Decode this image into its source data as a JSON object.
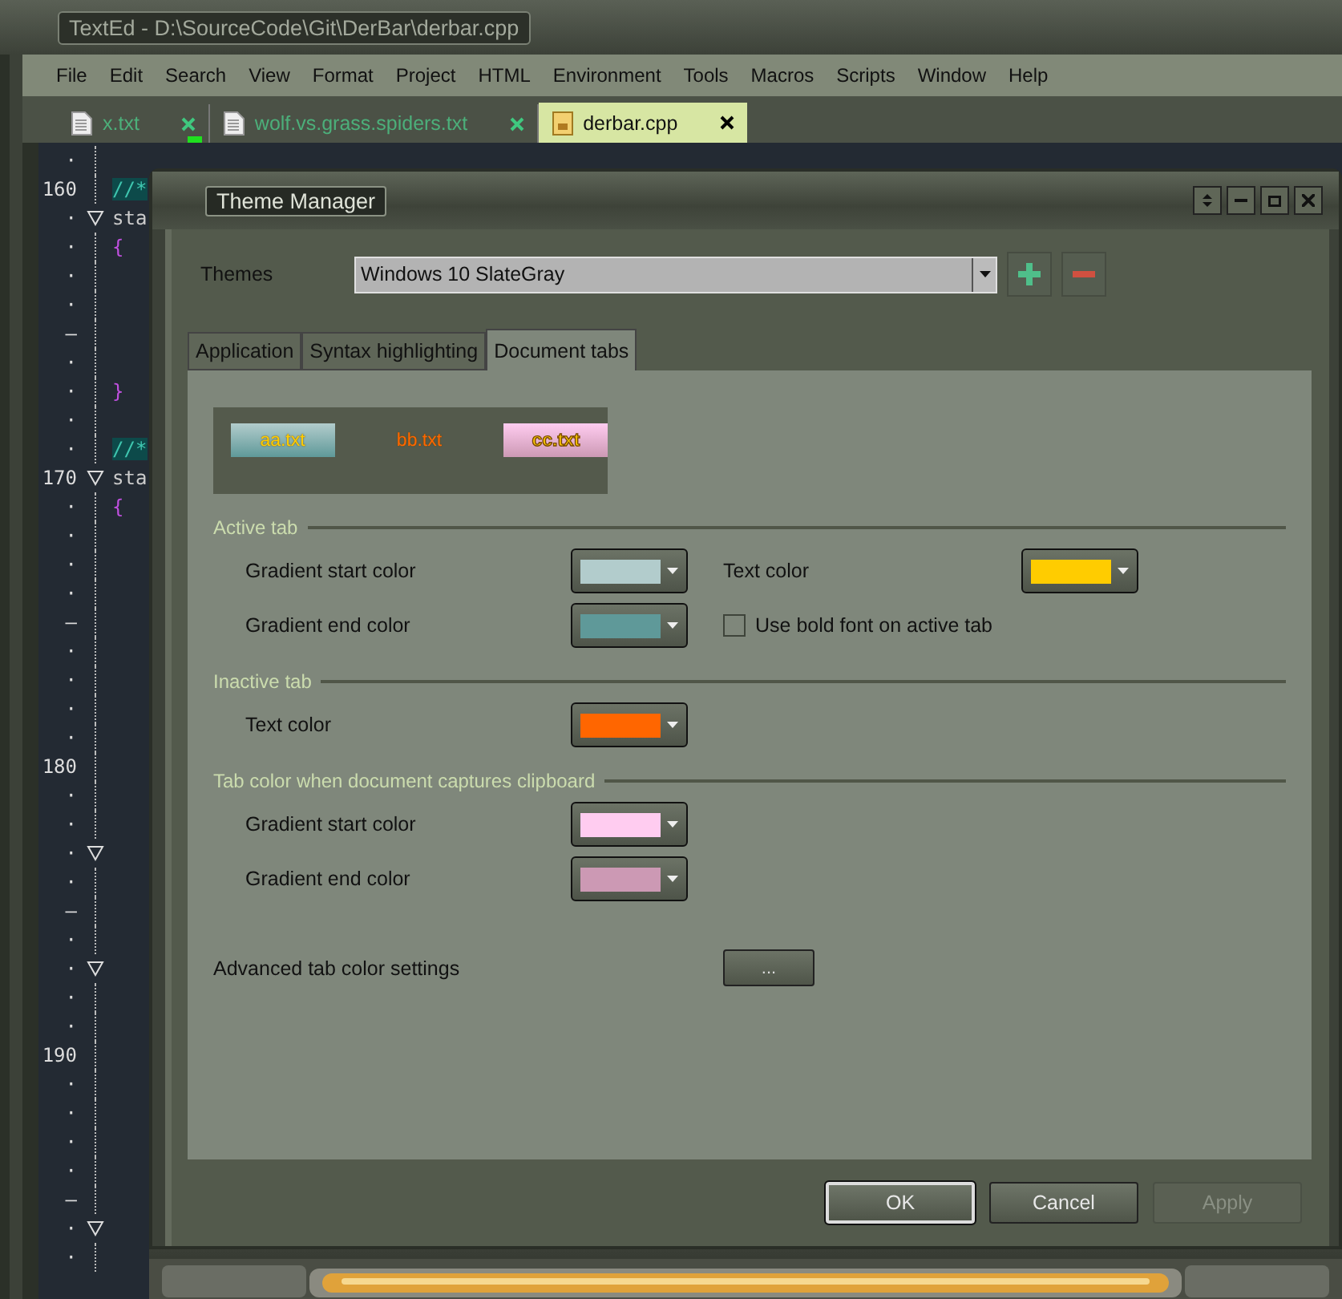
{
  "window": {
    "title": "TextEd - D:\\SourceCode\\Git\\DerBar\\derbar.cpp"
  },
  "menu": [
    "File",
    "Edit",
    "Search",
    "View",
    "Format",
    "Project",
    "HTML",
    "Environment",
    "Tools",
    "Macros",
    "Scripts",
    "Window",
    "Help"
  ],
  "doc_tabs": [
    {
      "label": "x.txt",
      "selected": false,
      "modified": true
    },
    {
      "label": "wolf.vs.grass.spiders.txt",
      "selected": false,
      "modified": false
    },
    {
      "label": "derbar.cpp",
      "selected": true,
      "modified": false
    }
  ],
  "editor": {
    "lines": [
      {
        "gutter": "·",
        "fold": false
      },
      {
        "gutter": "160",
        "fold": false,
        "code": "//*",
        "kind": "comment"
      },
      {
        "gutter": "·",
        "fold": true,
        "code": "sta",
        "kind": "code"
      },
      {
        "gutter": "·",
        "fold": false,
        "code": "{",
        "kind": "brace"
      },
      {
        "gutter": "·",
        "fold": false
      },
      {
        "gutter": "·",
        "fold": false
      },
      {
        "gutter": "–",
        "fold": false
      },
      {
        "gutter": "·",
        "fold": false
      },
      {
        "gutter": "·",
        "fold": false,
        "code": "}",
        "kind": "brace"
      },
      {
        "gutter": "·",
        "fold": false
      },
      {
        "gutter": "·",
        "fold": false,
        "code": "//*",
        "kind": "comment"
      },
      {
        "gutter": "170",
        "fold": true,
        "code": "sta",
        "kind": "code"
      },
      {
        "gutter": "·",
        "fold": false,
        "code": "{",
        "kind": "brace"
      },
      {
        "gutter": "·",
        "fold": false
      },
      {
        "gutter": "·",
        "fold": false
      },
      {
        "gutter": "·",
        "fold": false
      },
      {
        "gutter": "–",
        "fold": false
      },
      {
        "gutter": "·",
        "fold": false
      },
      {
        "gutter": "·",
        "fold": false
      },
      {
        "gutter": "·",
        "fold": false
      },
      {
        "gutter": "·",
        "fold": false
      },
      {
        "gutter": "180",
        "fold": false
      },
      {
        "gutter": "·",
        "fold": false
      },
      {
        "gutter": "·",
        "fold": false
      },
      {
        "gutter": "·",
        "fold": true
      },
      {
        "gutter": "·",
        "fold": false
      },
      {
        "gutter": "–",
        "fold": false
      },
      {
        "gutter": "·",
        "fold": false
      },
      {
        "gutter": "·",
        "fold": true
      },
      {
        "gutter": "·",
        "fold": false
      },
      {
        "gutter": "·",
        "fold": false
      },
      {
        "gutter": "190",
        "fold": false
      },
      {
        "gutter": "·",
        "fold": false
      },
      {
        "gutter": "·",
        "fold": false
      },
      {
        "gutter": "·",
        "fold": false
      },
      {
        "gutter": "·",
        "fold": false
      },
      {
        "gutter": "–",
        "fold": false
      },
      {
        "gutter": "·",
        "fold": true
      },
      {
        "gutter": "·",
        "fold": false
      }
    ]
  },
  "dialog": {
    "title": "Theme Manager",
    "themes_label": "Themes",
    "theme_value": "Windows 10 SlateGray",
    "tabs": [
      {
        "label": "Application",
        "selected": false
      },
      {
        "label": "Syntax highlighting",
        "selected": false
      },
      {
        "label": "Document tabs",
        "selected": true
      }
    ],
    "preview": [
      {
        "label": "aa.txt",
        "kind": "active"
      },
      {
        "label": "bb.txt",
        "kind": "inactive"
      },
      {
        "label": "cc.txt",
        "kind": "clipboard"
      }
    ],
    "groups": [
      {
        "heading": "Active tab",
        "columns": [
          [
            {
              "kind": "color",
              "label": "Gradient start color",
              "color": "#b2cccc"
            },
            {
              "kind": "color",
              "label": "Gradient end color",
              "color": "#5f9999"
            }
          ],
          [
            {
              "kind": "color",
              "label": "Text color",
              "color": "#ffcc00"
            },
            {
              "kind": "checkbox",
              "label": "Use bold font on active tab",
              "checked": false
            }
          ]
        ]
      },
      {
        "heading": "Inactive tab",
        "columns": [
          [
            {
              "kind": "color",
              "label": "Text color",
              "color": "#ff6600"
            }
          ]
        ]
      },
      {
        "heading": "Tab color when document captures clipboard",
        "columns": [
          [
            {
              "kind": "color",
              "label": "Gradient start color",
              "color": "#ffccf0"
            },
            {
              "kind": "color",
              "label": "Gradient end color",
              "color": "#cc99b4"
            }
          ]
        ]
      }
    ],
    "advanced_label": "Advanced tab color settings",
    "advanced_button": "...",
    "buttons": [
      {
        "label": "OK",
        "default": true,
        "disabled": false
      },
      {
        "label": "Cancel",
        "default": false,
        "disabled": false
      },
      {
        "label": "Apply",
        "default": false,
        "disabled": true
      }
    ]
  }
}
